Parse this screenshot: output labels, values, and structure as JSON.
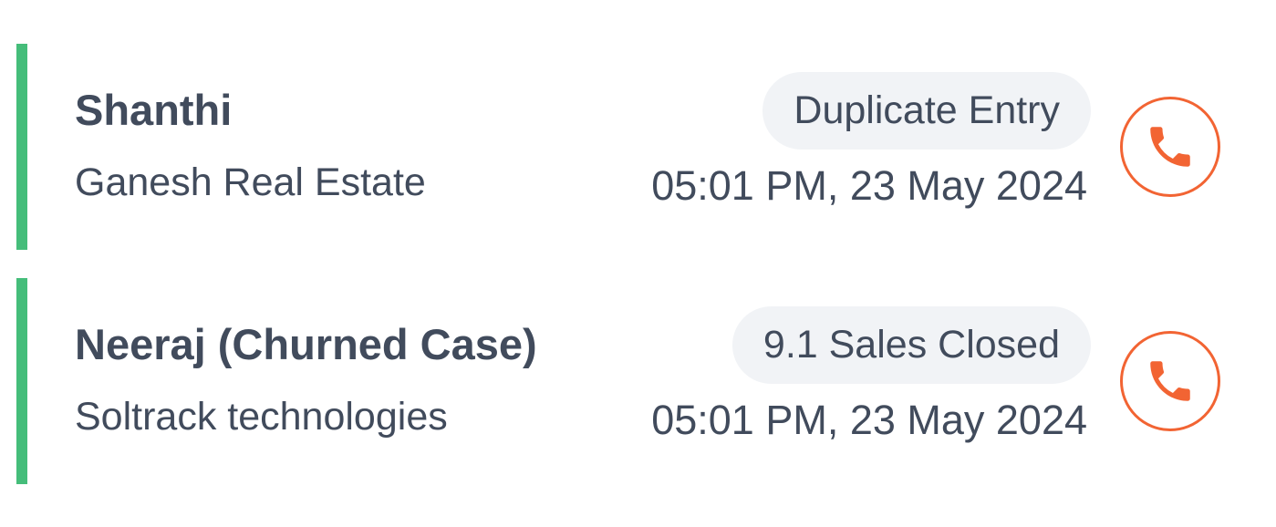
{
  "leads": [
    {
      "name": "Shanthi",
      "company": "Ganesh Real Estate",
      "status": "Duplicate Entry",
      "time": "05:01 PM, 23 May 2024",
      "icon": "phone-icon"
    },
    {
      "name": "Neeraj (Churned Case)",
      "company": "Soltrack technologies",
      "status": "9.1 Sales Closed",
      "time": "05:01 PM, 23 May 2024",
      "icon": "phone-icon"
    }
  ],
  "colors": {
    "accent_bar": "#45bd7a",
    "call_icon": "#f26433",
    "status_pill_bg": "#f1f3f6",
    "text": "#414b5c"
  }
}
